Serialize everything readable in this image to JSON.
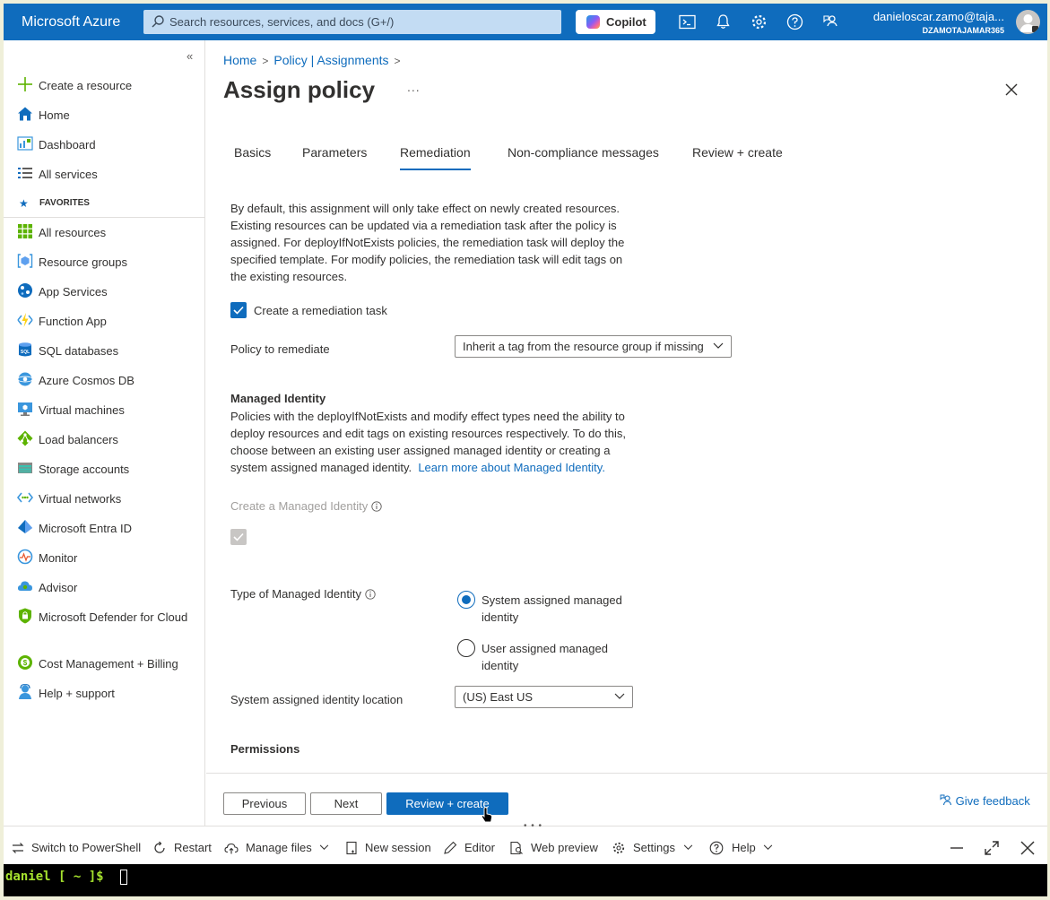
{
  "topbar": {
    "brand": "Microsoft Azure",
    "search_placeholder": "Search resources, services, and docs (G+/)",
    "copilot_label": "Copilot",
    "user_email": "danieloscar.zamo@taja...",
    "directory": "DZAMOTAJAMAR365",
    "icons": [
      "cloud-shell-icon",
      "notifications-icon",
      "settings-icon",
      "help-icon",
      "feedback-icon"
    ]
  },
  "sidebar": {
    "collapse_label": "«",
    "items": [
      {
        "label": "Create a resource",
        "icon": "plus-icon"
      },
      {
        "label": "Home",
        "icon": "home-icon"
      },
      {
        "label": "Dashboard",
        "icon": "dashboard-icon"
      },
      {
        "label": "All services",
        "icon": "list-icon"
      }
    ],
    "favorites_label": "FAVORITES",
    "favorites": [
      {
        "label": "All resources",
        "icon": "grid-icon"
      },
      {
        "label": "Resource groups",
        "icon": "resource-group-icon"
      },
      {
        "label": "App Services",
        "icon": "globe-icon"
      },
      {
        "label": "Function App",
        "icon": "bolt-icon"
      },
      {
        "label": "SQL databases",
        "icon": "sql-icon"
      },
      {
        "label": "Azure Cosmos DB",
        "icon": "cosmos-icon"
      },
      {
        "label": "Virtual machines",
        "icon": "monitor-icon"
      },
      {
        "label": "Load balancers",
        "icon": "diamond-icon"
      },
      {
        "label": "Storage accounts",
        "icon": "storage-icon"
      },
      {
        "label": "Virtual networks",
        "icon": "network-icon"
      },
      {
        "label": "Microsoft Entra ID",
        "icon": "entra-icon"
      },
      {
        "label": "Monitor",
        "icon": "gauge-icon"
      },
      {
        "label": "Advisor",
        "icon": "cloud-icon"
      },
      {
        "label": "Microsoft Defender for Cloud",
        "icon": "shield-icon"
      },
      {
        "label": "Cost Management + Billing",
        "icon": "cost-icon"
      },
      {
        "label": "Help + support",
        "icon": "person-icon"
      }
    ]
  },
  "main": {
    "breadcrumb": [
      "Home",
      "Policy | Assignments"
    ],
    "title": "Assign policy",
    "more_label": "...",
    "tabs": [
      "Basics",
      "Parameters",
      "Remediation",
      "Non-compliance messages",
      "Review + create"
    ],
    "active_tab": "Remediation",
    "intro": "By default, this assignment will only take effect on newly created resources. Existing resources can be updated via a remediation task after the policy is assigned. For deployIfNotExists policies, the remediation task will deploy the specified template. For modify policies, the remediation task will edit tags on the existing resources.",
    "create_task_label": "Create a remediation task",
    "create_task_checked": true,
    "policy_to_remediate_label": "Policy to remediate",
    "policy_to_remediate_value": "Inherit a tag from the resource group if missing",
    "managed_identity_heading": "Managed Identity",
    "managed_identity_text": "Policies with the deployIfNotExists and modify effect types need the ability to deploy resources and edit tags on existing resources respectively. To do this, choose between an existing user assigned managed identity or creating a system assigned managed identity.",
    "managed_identity_link": "Learn more about Managed Identity.",
    "create_identity_label": "Create a Managed Identity",
    "create_identity_checked": true,
    "identity_type_label": "Type of Managed Identity",
    "identity_options": [
      "System assigned managed identity",
      "User assigned managed identity"
    ],
    "identity_selected": "System assigned managed identity",
    "location_label": "System assigned identity location",
    "location_value": "(US) East US",
    "permissions_heading": "Permissions"
  },
  "footer": {
    "previous": "Previous",
    "next": "Next",
    "review_create": "Review + create",
    "feedback": "Give feedback"
  },
  "shell": {
    "switch": "Switch to PowerShell",
    "restart": "Restart",
    "manage_files": "Manage files",
    "new_session": "New session",
    "editor": "Editor",
    "web_preview": "Web preview",
    "settings": "Settings",
    "help": "Help",
    "prompt": "daniel [ ~ ]$"
  },
  "colors": {
    "accent": "#0f6cbd",
    "terminal_bg": "#000000",
    "prompt": "#a6e22e"
  }
}
